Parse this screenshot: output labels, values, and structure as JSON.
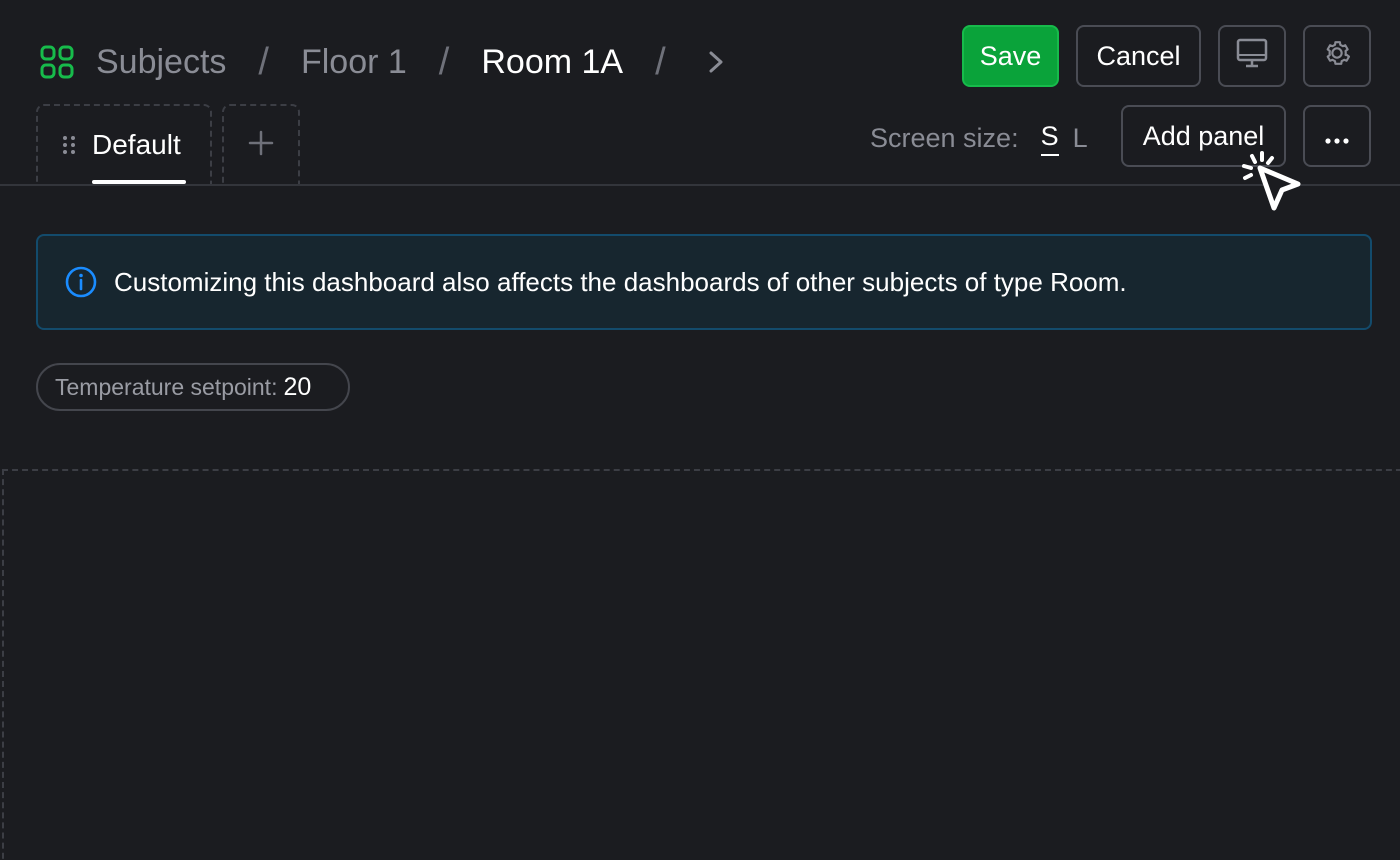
{
  "breadcrumb": {
    "icon": "grid-icon",
    "items": [
      "Subjects",
      "Floor 1",
      "Room 1A"
    ],
    "separator": "/"
  },
  "actions": {
    "save_label": "Save",
    "cancel_label": "Cancel",
    "display_icon": "monitor-icon",
    "settings_icon": "gear-icon",
    "add_panel_label": "Add panel",
    "more_label": "···"
  },
  "tabs": {
    "items": [
      {
        "label": "Default",
        "selected": true
      }
    ],
    "add_label": "+"
  },
  "screen_size": {
    "label": "Screen size:",
    "options": [
      "S",
      "L"
    ],
    "selected": "S"
  },
  "banner": {
    "icon": "info-icon",
    "text": "Customizing this dashboard also affects the dashboards of other subjects of type Room."
  },
  "chip": {
    "label": "Temperature setpoint:",
    "value": "20"
  },
  "colors": {
    "background": "#1b1c20",
    "accent_green": "#0aa33a",
    "info_blue": "#1a8cff",
    "banner_bg": "#17262f"
  }
}
